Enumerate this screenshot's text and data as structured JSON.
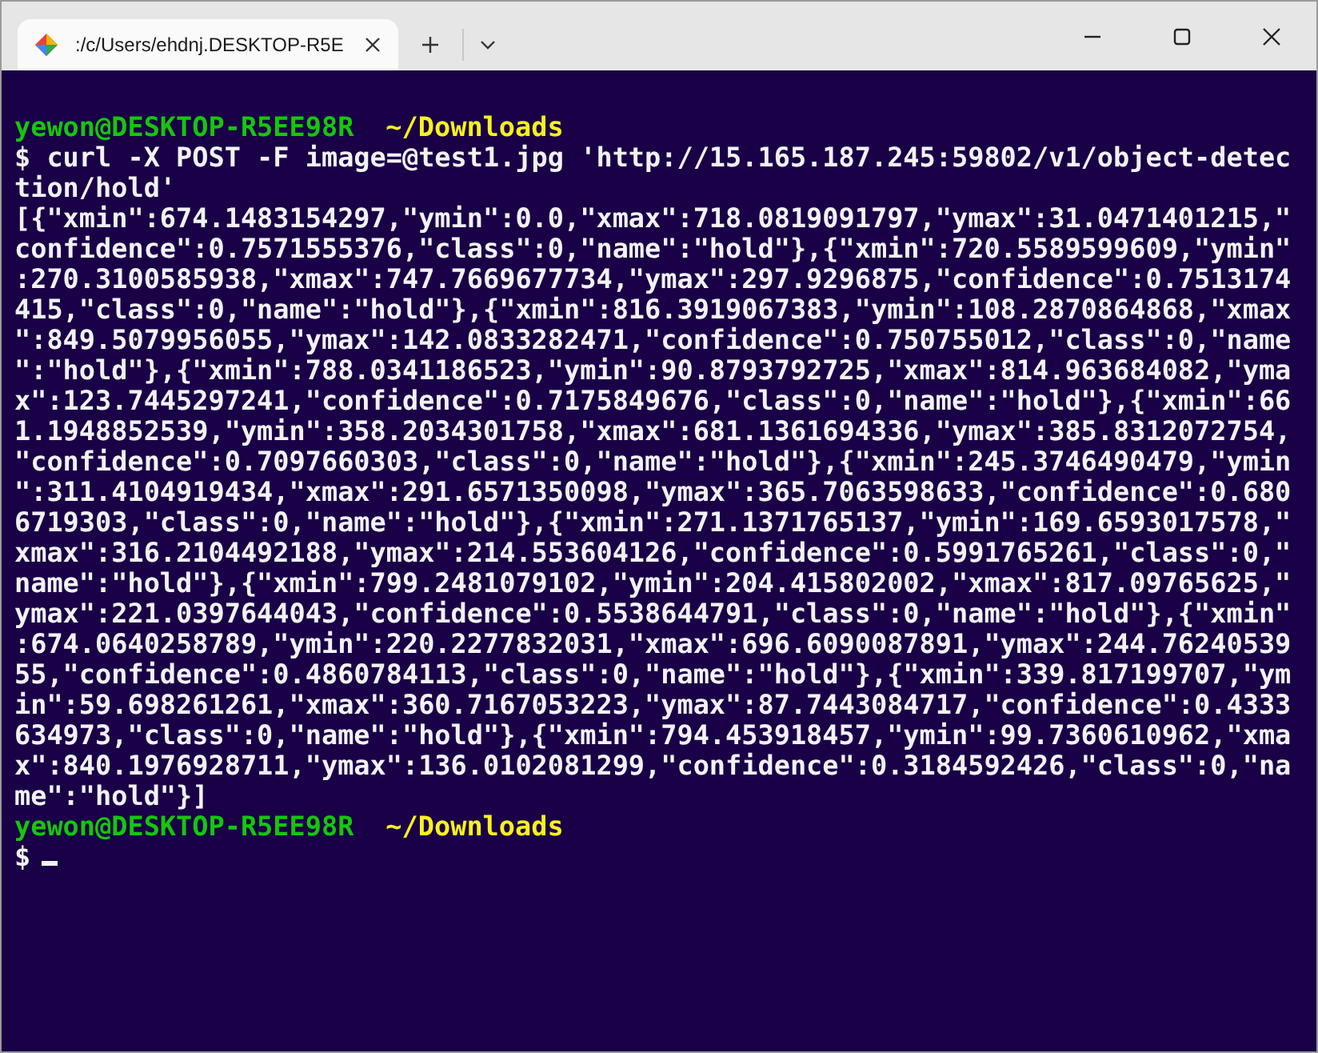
{
  "window": {
    "tab": {
      "title": ":/c/Users/ehdnj.DESKTOP-R5E",
      "selected": true
    }
  },
  "terminal": {
    "lines": [
      {
        "kind": "prompt",
        "user": "yewon@DESKTOP-R5EE98R",
        "path": "~/Downloads"
      },
      {
        "kind": "output",
        "text": "$ curl -X POST -F image=@test1.jpg 'http://15.165.187.245:59802/v1/object-detec"
      },
      {
        "kind": "output",
        "text": "tion/hold'"
      },
      {
        "kind": "output",
        "text": "[{\"xmin\":674.1483154297,\"ymin\":0.0,\"xmax\":718.0819091797,\"ymax\":31.0471401215,\""
      },
      {
        "kind": "output",
        "text": "confidence\":0.7571555376,\"class\":0,\"name\":\"hold\"},{\"xmin\":720.5589599609,\"ymin\""
      },
      {
        "kind": "output",
        "text": ":270.3100585938,\"xmax\":747.7669677734,\"ymax\":297.9296875,\"confidence\":0.7513174"
      },
      {
        "kind": "output",
        "text": "415,\"class\":0,\"name\":\"hold\"},{\"xmin\":816.3919067383,\"ymin\":108.2870864868,\"xmax"
      },
      {
        "kind": "output",
        "text": "\":849.5079956055,\"ymax\":142.0833282471,\"confidence\":0.750755012,\"class\":0,\"name"
      },
      {
        "kind": "output",
        "text": "\":\"hold\"},{\"xmin\":788.0341186523,\"ymin\":90.8793792725,\"xmax\":814.963684082,\"yma"
      },
      {
        "kind": "output",
        "text": "x\":123.7445297241,\"confidence\":0.7175849676,\"class\":0,\"name\":\"hold\"},{\"xmin\":66"
      },
      {
        "kind": "output",
        "text": "1.1948852539,\"ymin\":358.2034301758,\"xmax\":681.1361694336,\"ymax\":385.8312072754,"
      },
      {
        "kind": "output",
        "text": "\"confidence\":0.7097660303,\"class\":0,\"name\":\"hold\"},{\"xmin\":245.3746490479,\"ymin"
      },
      {
        "kind": "output",
        "text": "\":311.4104919434,\"xmax\":291.6571350098,\"ymax\":365.7063598633,\"confidence\":0.680"
      },
      {
        "kind": "output",
        "text": "6719303,\"class\":0,\"name\":\"hold\"},{\"xmin\":271.1371765137,\"ymin\":169.6593017578,\""
      },
      {
        "kind": "output",
        "text": "xmax\":316.2104492188,\"ymax\":214.553604126,\"confidence\":0.5991765261,\"class\":0,\""
      },
      {
        "kind": "output",
        "text": "name\":\"hold\"},{\"xmin\":799.2481079102,\"ymin\":204.415802002,\"xmax\":817.09765625,\""
      },
      {
        "kind": "output",
        "text": "ymax\":221.0397644043,\"confidence\":0.5538644791,\"class\":0,\"name\":\"hold\"},{\"xmin\""
      },
      {
        "kind": "output",
        "text": ":674.0640258789,\"ymin\":220.2277832031,\"xmax\":696.6090087891,\"ymax\":244.76240539"
      },
      {
        "kind": "output",
        "text": "55,\"confidence\":0.4860784113,\"class\":0,\"name\":\"hold\"},{\"xmin\":339.817199707,\"ym"
      },
      {
        "kind": "output",
        "text": "in\":59.698261261,\"xmax\":360.7167053223,\"ymax\":87.7443084717,\"confidence\":0.4333"
      },
      {
        "kind": "output",
        "text": "634973,\"class\":0,\"name\":\"hold\"},{\"xmin\":794.453918457,\"ymin\":99.7360610962,\"xma"
      },
      {
        "kind": "output",
        "text": "x\":840.1976928711,\"ymax\":136.0102081299,\"confidence\":0.3184592426,\"class\":0,\"na"
      },
      {
        "kind": "output",
        "text": "me\":\"hold\"}]"
      },
      {
        "kind": "prompt",
        "user": "yewon@DESKTOP-R5EE98R",
        "path": "~/Downloads"
      },
      {
        "kind": "input",
        "text": "$",
        "cursor": true
      }
    ]
  }
}
